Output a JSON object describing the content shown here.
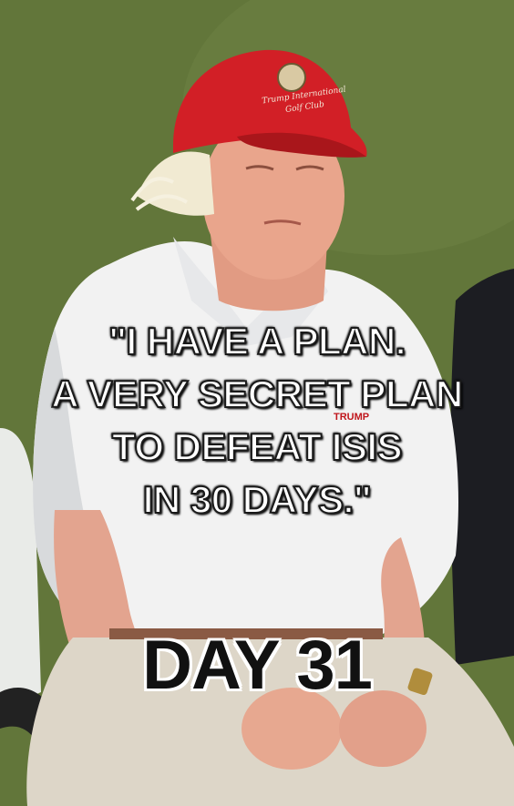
{
  "meme": {
    "quote_lines": [
      "\"I HAVE A PLAN.",
      "A VERY SECRET PLAN",
      "TO DEFEAT ISIS",
      "IN 30 DAYS.\""
    ],
    "punchline": "DAY 31"
  },
  "photo": {
    "cap_text_line1": "Trump International",
    "cap_text_line2": "Golf Club",
    "shirt_logo": "TRUMP",
    "colors": {
      "background_grass": "#5f7438",
      "cap_red": "#d21f26",
      "shirt_white": "#f2f2f2",
      "pants_khaki": "#ddd6c8",
      "skin": "#e6a08a",
      "hair": "#f1ead2"
    }
  }
}
